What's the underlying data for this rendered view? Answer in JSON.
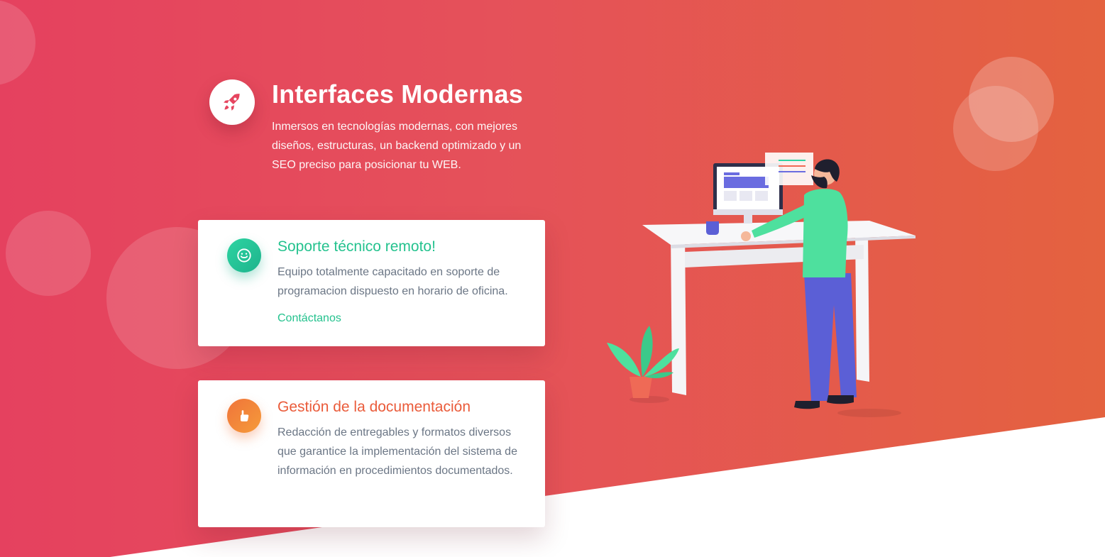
{
  "feature": {
    "icon": "rocket-icon",
    "title": "Interfaces Modernas",
    "description": "Inmersos en tecnologías modernas, con mejores diseños, estructuras, un backend optimizado y un SEO preciso para posicionar tu WEB."
  },
  "cards": [
    {
      "icon": "smile-icon",
      "title": "Soporte técnico remoto!",
      "text": "Equipo totalmente capacitado en soporte de programacion dispuesto en horario de oficina.",
      "link": "Contáctanos",
      "accent": "#24c28e"
    },
    {
      "icon": "thumbs-up-icon",
      "title": "Gestión de la documentación",
      "text": "Redacción de entregables y formatos diversos que garantice la implementación del sistema de información en procedimientos documentados.",
      "accent": "#ea5b3a"
    }
  ],
  "colors": {
    "hero_gradient_start": "#e5415f",
    "hero_gradient_end": "#e4623f",
    "card_text": "#6b7685"
  },
  "illustration": "man-at-standing-desk-illustration"
}
